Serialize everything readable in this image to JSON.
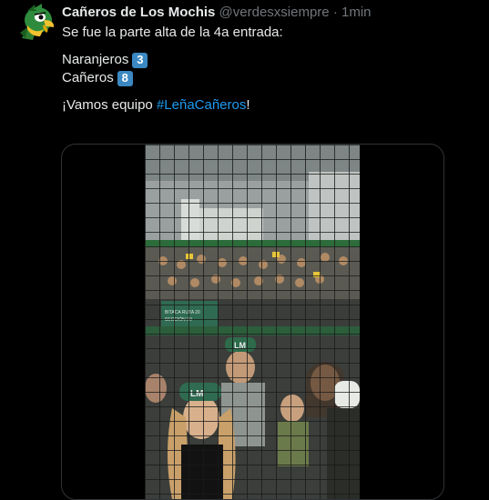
{
  "tweet": {
    "display_name": "Cañeros de Los Mochis",
    "handle": "@verdesxsiempre",
    "separator": "·",
    "time": "1min",
    "line1": "Se fue la parte alta de la 4a entrada:",
    "team1_name": "Naranjeros",
    "team1_score": "3",
    "team2_name": "Cañeros",
    "team2_score": "8",
    "closing_prefix": "¡Vamos equipo ",
    "hashtag": "#LeñaCañeros",
    "closing_suffix": "!"
  },
  "media": {
    "type": "video",
    "banner_text": "BITACA RUTA 20 SECCIÓN 20",
    "cap_logo": "LM"
  },
  "colors": {
    "background": "#000000",
    "text": "#e7e9ea",
    "muted": "#71767b",
    "link": "#1d9bf0",
    "badge": "#3b88c3",
    "avatar_green": "#1f7a3a",
    "avatar_yellow": "#f2c12e"
  },
  "icons": {
    "avatar": "canero-parrot-mascot-icon",
    "score_badge": "keycap-number-icon"
  }
}
